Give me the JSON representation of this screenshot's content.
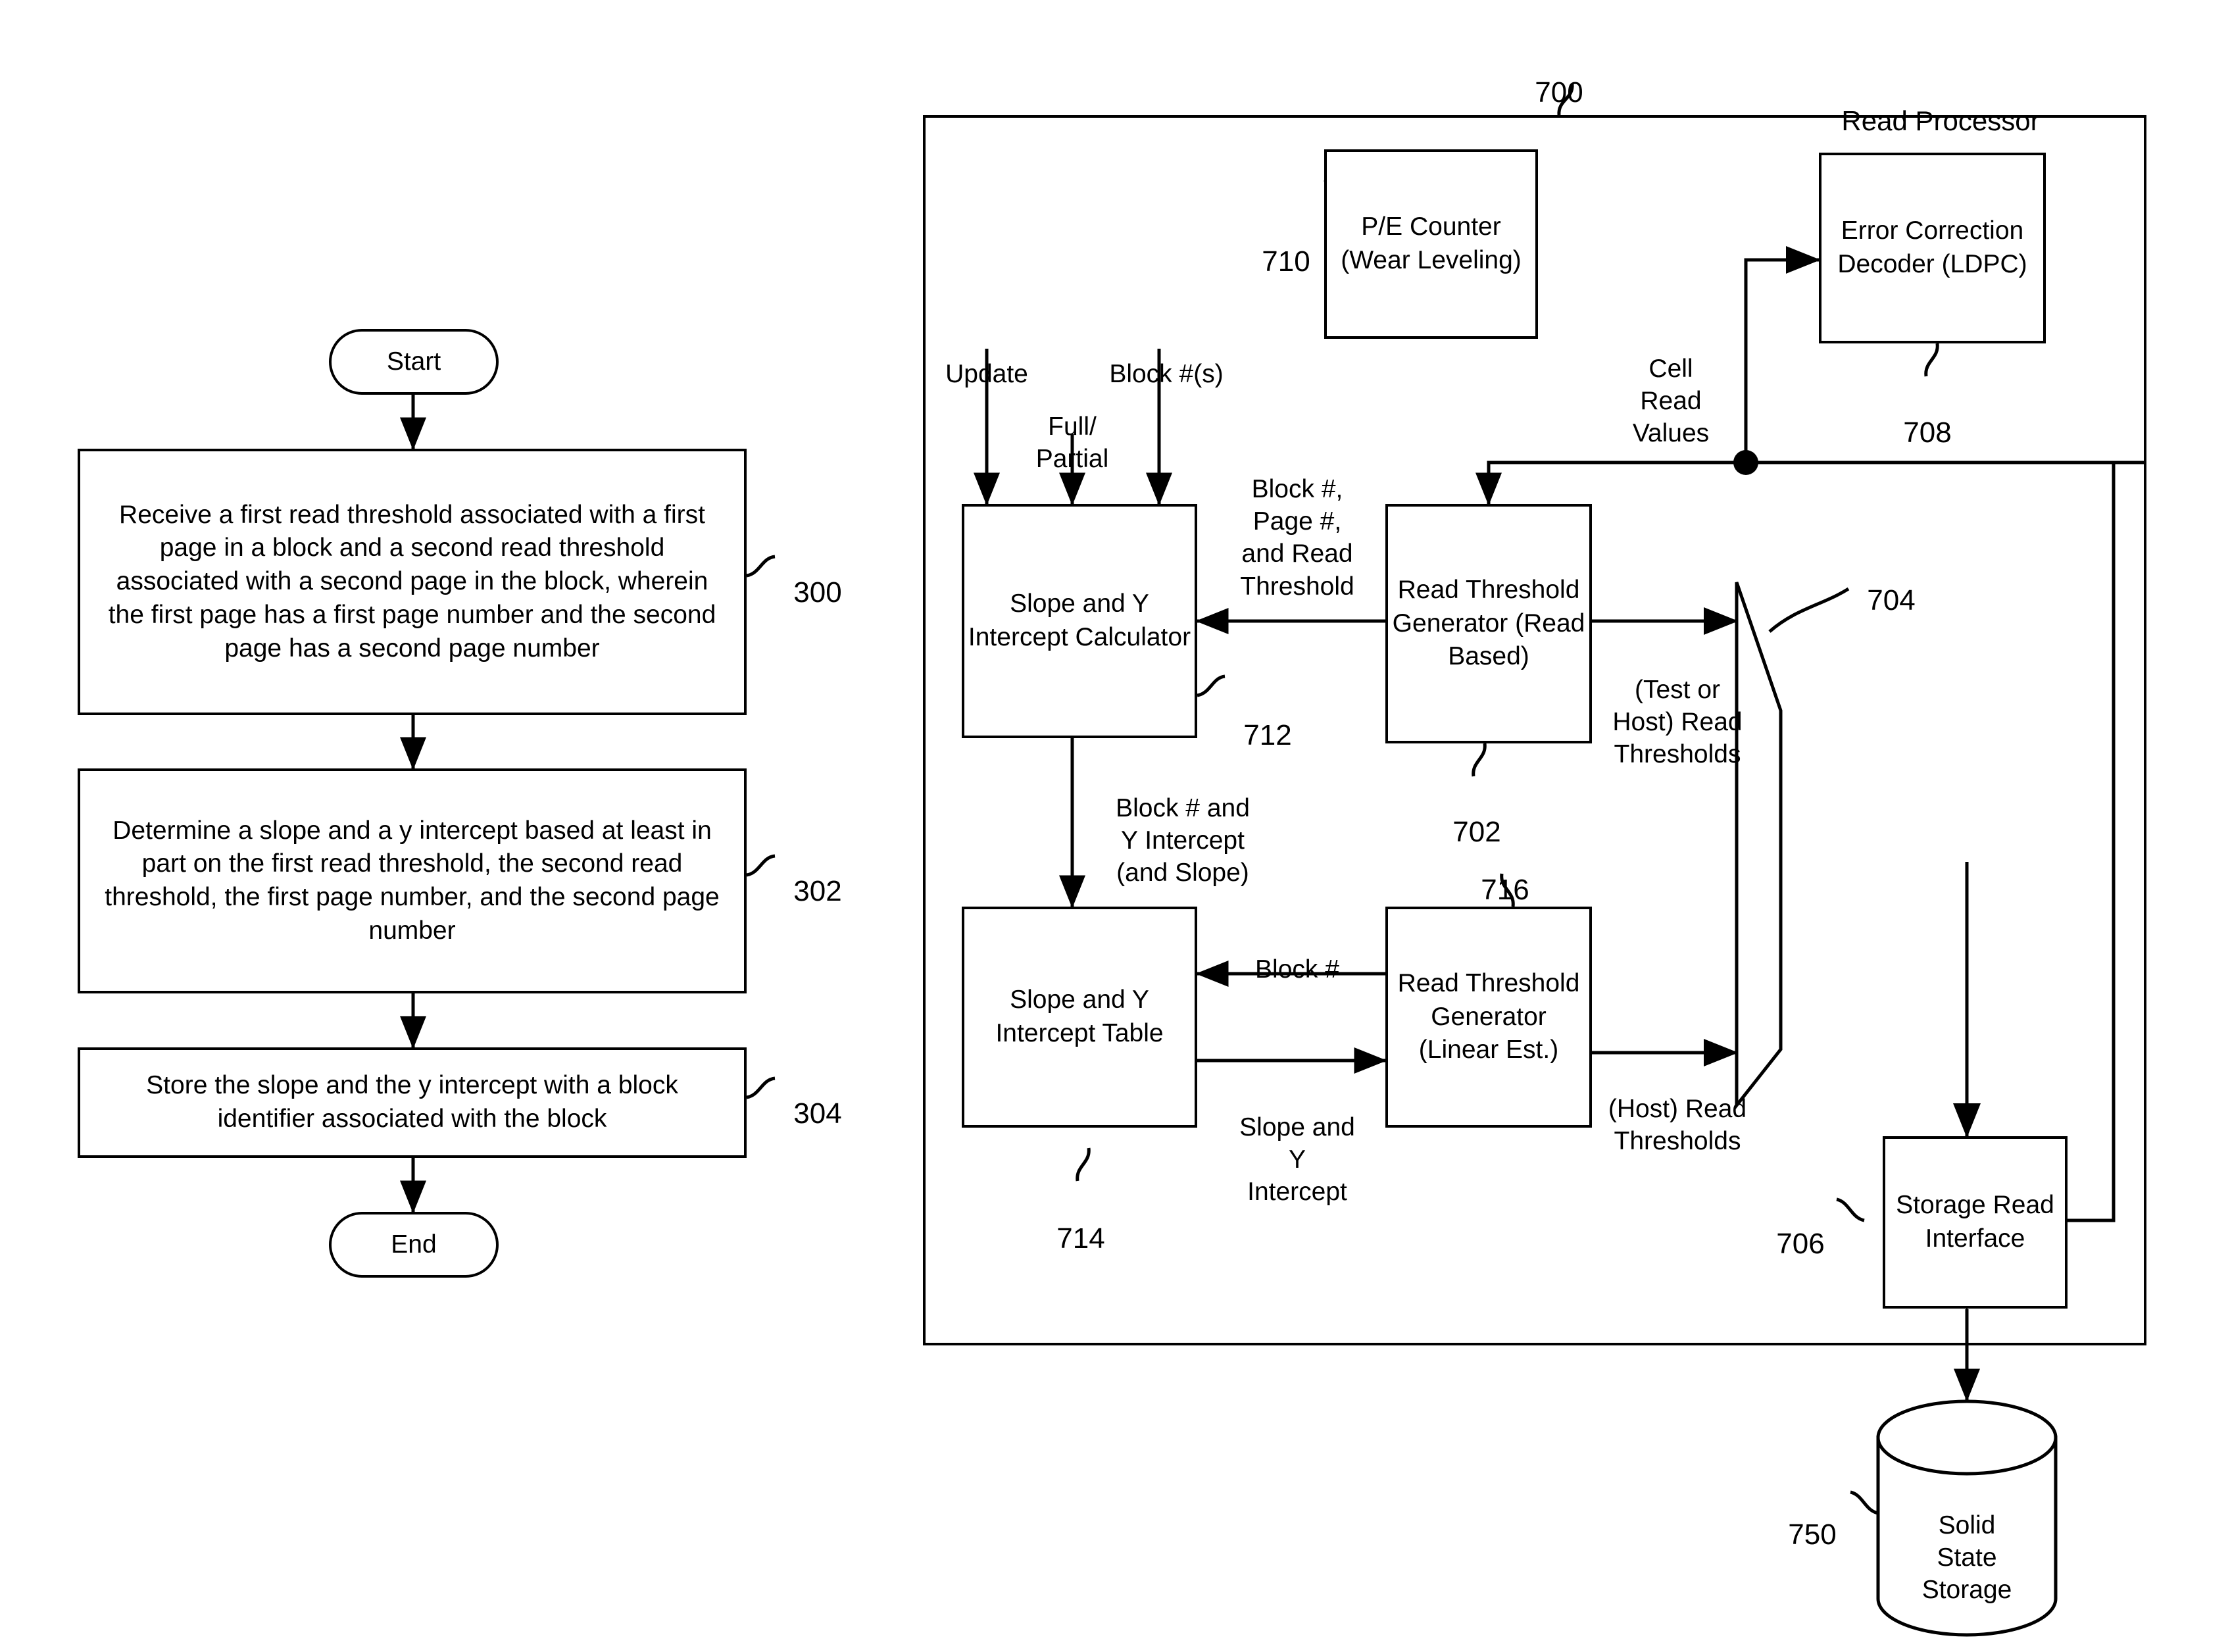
{
  "figure_left": {
    "name": "flowchart-300",
    "start_label": "Start",
    "end_label": "End",
    "steps": [
      {
        "ref": "300",
        "text": "Receive a first read threshold associated with a first page in a block and a second read threshold associated with a second page in the block, wherein the first page has a first page number and the second page has a second page number"
      },
      {
        "ref": "302",
        "text": "Determine a slope and a y intercept based at least in part on the first read threshold, the second read threshold, the first page number, and the second page number"
      },
      {
        "ref": "304",
        "text": "Store the slope and the y intercept with a block identifier associated with the block"
      }
    ]
  },
  "figure_right": {
    "name": "read-processor-block-diagram",
    "system_ref": "700",
    "system_title": "Read Processor",
    "blocks": [
      {
        "ref": "710",
        "label": "P/E\nCounter\n(Wear\nLeveling)"
      },
      {
        "ref": "708",
        "label": "Error\nCorrection\nDecoder\n(LDPC)"
      },
      {
        "ref": "712",
        "label": "Slope and\nY Intercept\nCalculator"
      },
      {
        "ref": "702",
        "label": "Read\nThreshold\nGenerator\n(Read Based)"
      },
      {
        "ref": "714",
        "label": "Slope and\nY Intercept\nTable"
      },
      {
        "ref": "716",
        "label": "Read\nThreshold\nGenerator\n(Linear Est.)"
      },
      {
        "ref": "704",
        "label": ""
      },
      {
        "ref": "706",
        "label": "Storage\nRead\nInterface"
      },
      {
        "ref": "750",
        "label": "Solid\nState\nStorage"
      }
    ],
    "mux_ref": "704",
    "signals": {
      "update": "Update",
      "block_numbers": "Block #(s)",
      "full_partial": "Full/\nPartial",
      "block_page_threshold": "Block #,\nPage #,\nand Read\nThreshold",
      "cell_read_values": "Cell\nRead\nValues",
      "block_and_y_intercept": "Block # and\nY Intercept\n(and Slope)",
      "block_number": "Block #",
      "slope_and_y_intercept": "Slope and\nY\nIntercept",
      "test_or_host_thresholds": "(Test or\nHost) Read\nThresholds",
      "host_thresholds": "(Host) Read\nThresholds"
    }
  },
  "colors": {
    "line": "#000000",
    "background": "#ffffff"
  }
}
